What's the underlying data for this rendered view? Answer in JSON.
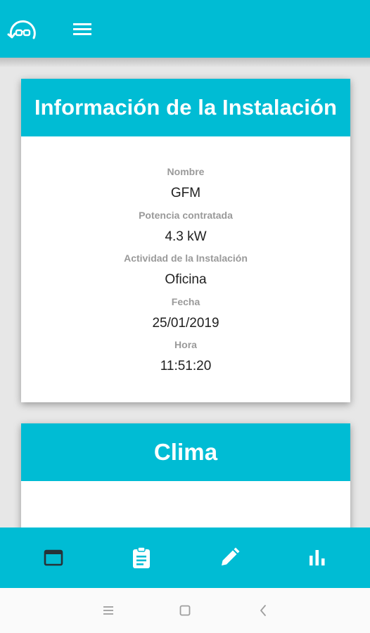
{
  "app": {
    "logo_icon": "glasses-face-logo-icon",
    "menu_icon": "hamburger-menu-icon",
    "accent_color": "#00bcd4"
  },
  "installation_card": {
    "title": "Información de la Instalación",
    "fields": [
      {
        "label": "Nombre",
        "value": "GFM"
      },
      {
        "label": "Potencia contratada",
        "value": "4.3 kW"
      },
      {
        "label": "Actividad de la Instalación",
        "value": "Oficina"
      },
      {
        "label": "Fecha",
        "value": "25/01/2019"
      },
      {
        "label": "Hora",
        "value": "11:51:20"
      }
    ]
  },
  "weather_card": {
    "title": "Clima"
  },
  "bottom_nav": {
    "items": [
      {
        "icon": "window-icon",
        "active": true
      },
      {
        "icon": "clipboard-icon",
        "active": false
      },
      {
        "icon": "pencil-icon",
        "active": false
      },
      {
        "icon": "bar-chart-icon",
        "active": false
      }
    ]
  },
  "system_nav": {
    "items": [
      "recents-icon",
      "home-icon",
      "back-icon"
    ]
  }
}
